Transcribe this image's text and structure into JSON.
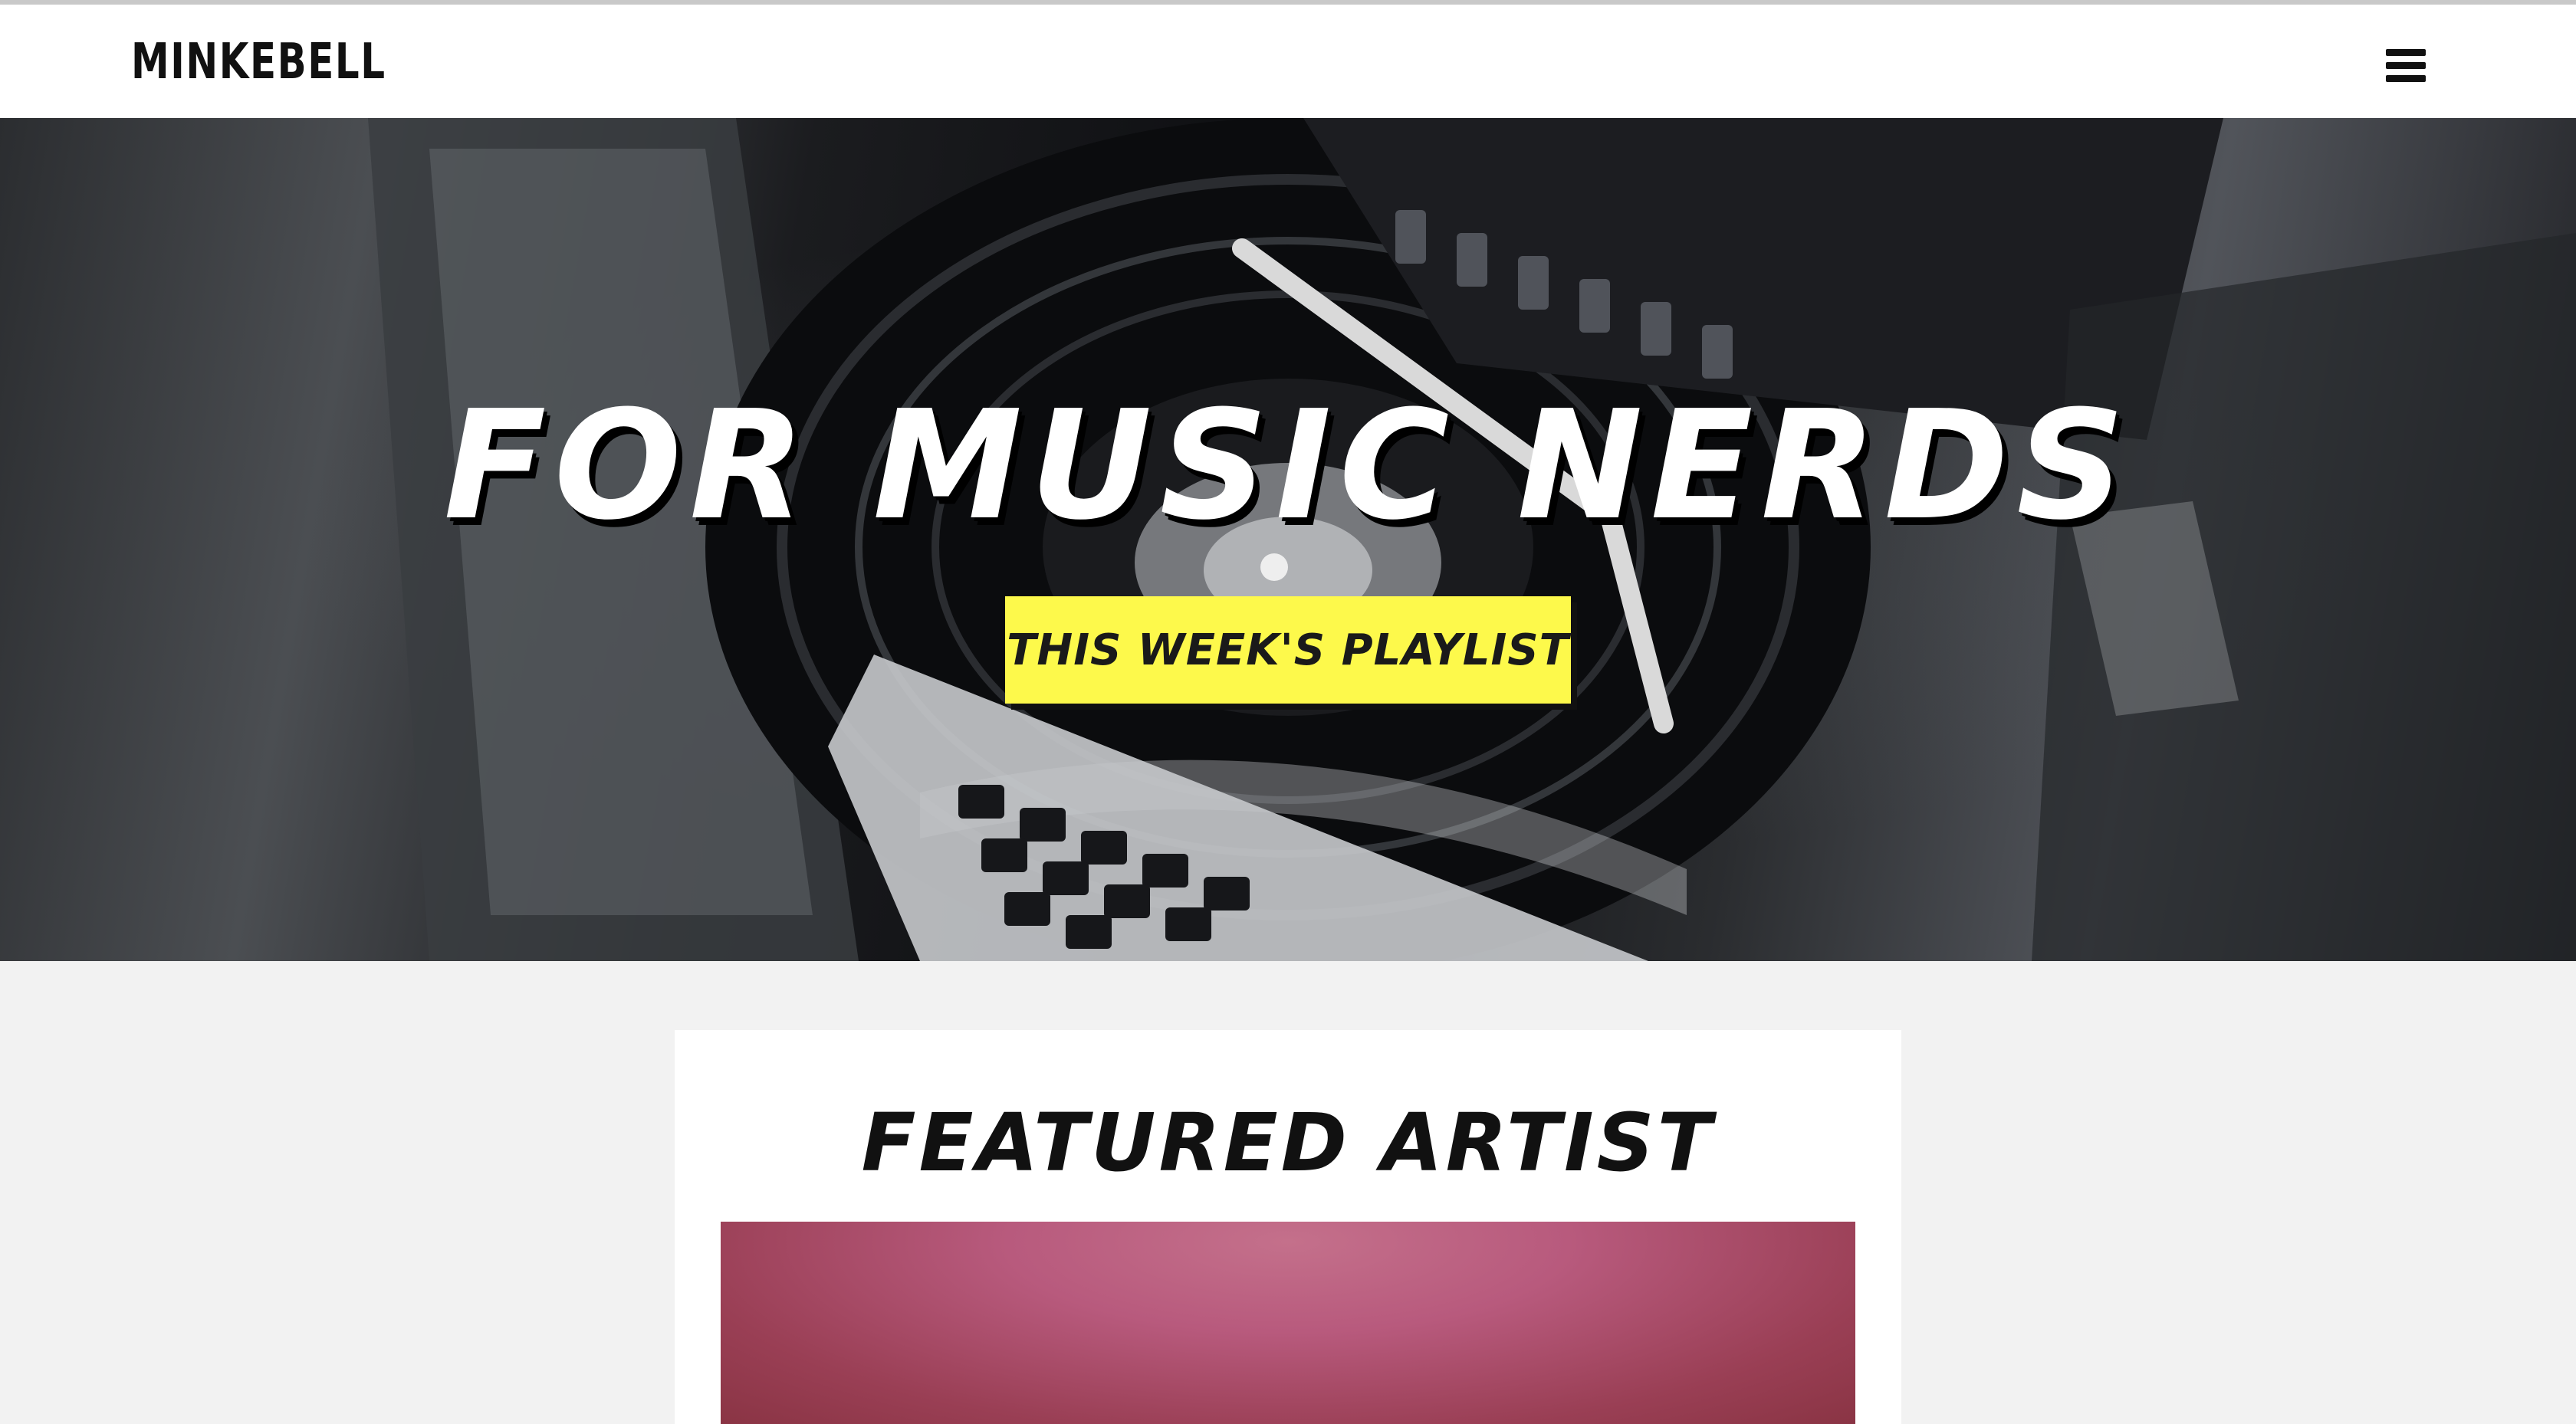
{
  "header": {
    "brand": "MINKEBELL",
    "menu_icon": "hamburger-menu-icon"
  },
  "hero": {
    "title": "FOR MUSIC NERDS",
    "cta_label": "THIS WEEK'S PLAYLIST",
    "background_image": "dj turntable and laptop photo (grayscale)",
    "cta_color": "#fdf94b"
  },
  "featured": {
    "title": "FEATURED ARTIST",
    "image": "featured artist photo (pink backdrop)"
  },
  "colors": {
    "page_bg": "#f2f2f2",
    "navbar_bg": "#ffffff",
    "accent_yellow": "#fdf94b",
    "text": "#111111"
  }
}
